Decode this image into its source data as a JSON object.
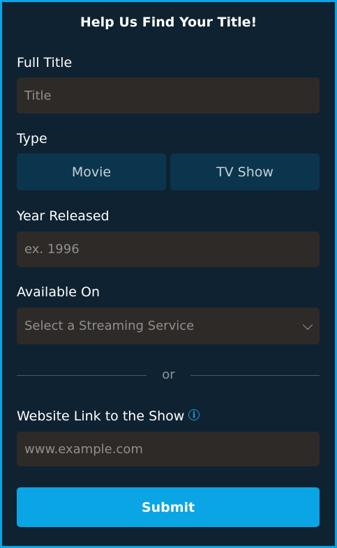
{
  "header": {
    "title": "Help Us Find Your Title!"
  },
  "full_title": {
    "label": "Full Title",
    "placeholder": "Title"
  },
  "type": {
    "label": "Type",
    "options": [
      "Movie",
      "TV Show"
    ]
  },
  "year": {
    "label": "Year Released",
    "placeholder": "ex. 1996"
  },
  "available_on": {
    "label": "Available On",
    "placeholder": "Select a Streaming Service"
  },
  "divider": {
    "text": "or"
  },
  "website": {
    "label": "Website Link to the Show",
    "placeholder": "www.example.com",
    "info_icon": "info-icon"
  },
  "submit": {
    "label": "Submit"
  },
  "colors": {
    "background": "#0f2231",
    "border_accent": "#0aa5e4",
    "field_bg": "#2e2a28",
    "segment_bg": "#0b354d",
    "info_icon": "#1e9be0"
  }
}
